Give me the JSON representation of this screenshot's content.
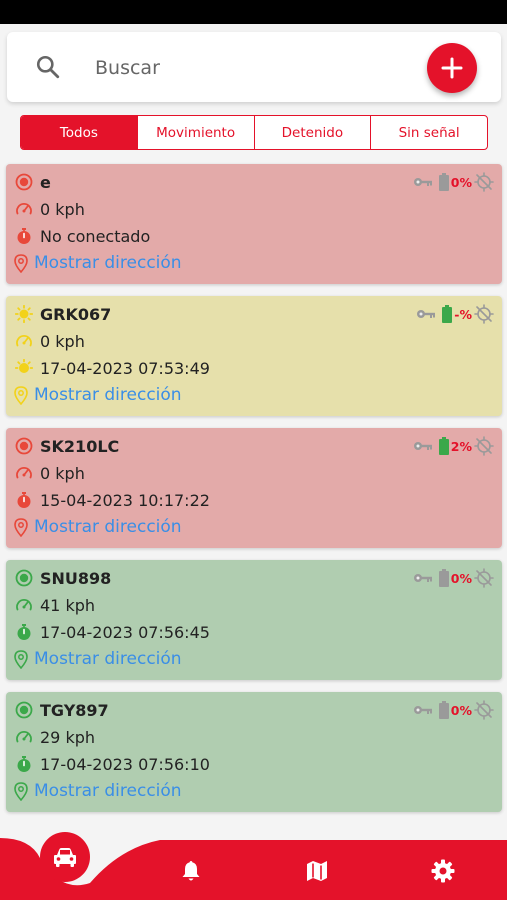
{
  "search": {
    "placeholder": "Buscar",
    "value": ""
  },
  "tabs": [
    {
      "label": "Todos",
      "active": true
    },
    {
      "label": "Movimiento",
      "active": false
    },
    {
      "label": "Detenido",
      "active": false
    },
    {
      "label": "Sin señal",
      "active": false
    }
  ],
  "vehicles": [
    {
      "name": "e",
      "status_color": "red",
      "speed": "0 kph",
      "time": "No conectado",
      "address_link": "Mostrar dirección",
      "battery": "0%",
      "battery_state": "empty"
    },
    {
      "name": "GRK067",
      "status_color": "yellow",
      "speed": "0 kph",
      "time": "17-04-2023 07:53:49",
      "address_link": "Mostrar dirección",
      "battery": "-%",
      "battery_state": "full"
    },
    {
      "name": "SK210LC",
      "status_color": "red",
      "speed": "0 kph",
      "time": "15-04-2023 10:17:22",
      "address_link": "Mostrar dirección",
      "battery": "2%",
      "battery_state": "full"
    },
    {
      "name": "SNU898",
      "status_color": "green",
      "speed": "41 kph",
      "time": "17-04-2023 07:56:45",
      "address_link": "Mostrar dirección",
      "battery": "0%",
      "battery_state": "empty"
    },
    {
      "name": "TGY897",
      "status_color": "green",
      "speed": "29 kph",
      "time": "17-04-2023 07:56:10",
      "address_link": "Mostrar dirección",
      "battery": "0%",
      "battery_state": "empty"
    }
  ],
  "nav": [
    {
      "icon": "car-icon",
      "active": true
    },
    {
      "icon": "bell-icon",
      "active": false
    },
    {
      "icon": "map-icon",
      "active": false
    },
    {
      "icon": "gear-icon",
      "active": false
    }
  ],
  "colors": {
    "accent": "#e4122a",
    "red_icon": "#e8483a",
    "yellow_icon": "#f2d21a",
    "green_icon": "#3ba84a",
    "link": "#3a8ee6"
  }
}
